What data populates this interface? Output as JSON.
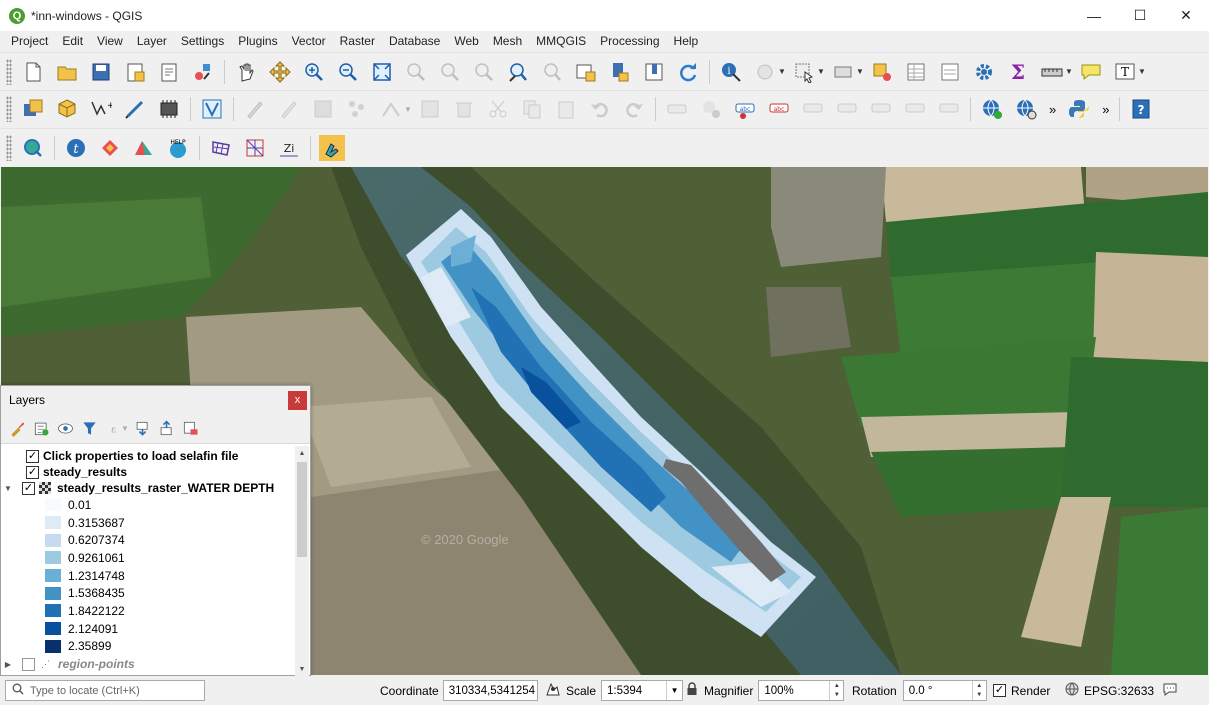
{
  "window": {
    "title": "*inn-windows - QGIS",
    "minimize": "—",
    "maximize": "☐",
    "close": "✕"
  },
  "menu": [
    "Project",
    "Edit",
    "View",
    "Layer",
    "Settings",
    "Plugins",
    "Vector",
    "Raster",
    "Database",
    "Web",
    "Mesh",
    "MMQGIS",
    "Processing",
    "Help"
  ],
  "map": {
    "watermark": "© 2020 Google"
  },
  "layers_panel": {
    "title": "Layers",
    "close": "x",
    "layers": [
      {
        "name": "Click properties to load selafin file",
        "checked": true
      },
      {
        "name": "steady_results",
        "checked": true
      },
      {
        "name": "steady_results_raster_WATER DEPTH",
        "checked": true,
        "expanded": true
      },
      {
        "name": "region-points",
        "checked": false
      }
    ],
    "legend": [
      {
        "value": "0.01",
        "color": "#f7fbff"
      },
      {
        "value": "0.3153687",
        "color": "#deebf7"
      },
      {
        "value": "0.6207374",
        "color": "#c6dbef"
      },
      {
        "value": "0.9261061",
        "color": "#9ecae1"
      },
      {
        "value": "1.2314748",
        "color": "#6baed6"
      },
      {
        "value": "1.5368435",
        "color": "#4292c6"
      },
      {
        "value": "1.8422122",
        "color": "#2171b5"
      },
      {
        "value": "2.124091",
        "color": "#08519c"
      },
      {
        "value": "2.35899",
        "color": "#08306b"
      }
    ]
  },
  "statusbar": {
    "locate_placeholder": "Type to locate (Ctrl+K)",
    "coordinate_label": "Coordinate",
    "coordinate_value": "310334,5341254",
    "scale_label": "Scale",
    "scale_value": "1:5394",
    "magnifier_label": "Magnifier",
    "magnifier_value": "100%",
    "rotation_label": "Rotation",
    "rotation_value": "0.0 °",
    "render_label": "Render",
    "render_checked": true,
    "crs": "EPSG:32633"
  }
}
